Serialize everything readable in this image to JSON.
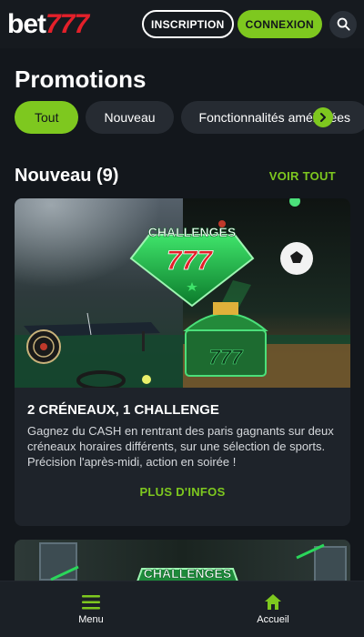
{
  "header": {
    "logo_text_main": "bet",
    "logo_text_accent": "777",
    "signup_label": "INSCRIPTION",
    "login_label": "CONNEXION",
    "search_icon": "search-icon"
  },
  "page": {
    "title": "Promotions"
  },
  "filters": {
    "chips": [
      {
        "label": "Tout",
        "active": true
      },
      {
        "label": "Nouveau",
        "active": false
      },
      {
        "label": "Fonctionnalités améliorées",
        "active": false
      }
    ],
    "scroll_icon": "chevron-right-icon"
  },
  "section": {
    "title": "Nouveau (9)",
    "see_all_label": "VOIR TOUT"
  },
  "promo_card": {
    "image_text": "CHALLENGES",
    "image_number": "777",
    "title": "2 CRÉNEAUX, 1 CHALLENGE",
    "description": "Gagnez du CASH en rentrant des paris gagnants sur deux créneaux horaires différents, sur une sélection de sports. Précision l'après-midi, action en soirée !",
    "cta_label": "PLUS D'INFOS"
  },
  "promo_card_2": {
    "image_text": "CHALLENGES"
  },
  "bottom_nav": {
    "items": [
      {
        "label": "Menu",
        "icon": "hamburger-icon"
      },
      {
        "label": "Accueil",
        "icon": "home-icon"
      }
    ]
  },
  "colors": {
    "accent": "#7ec81f",
    "brand_red": "#e3202a",
    "background": "#13171c",
    "card": "#1e232a"
  }
}
